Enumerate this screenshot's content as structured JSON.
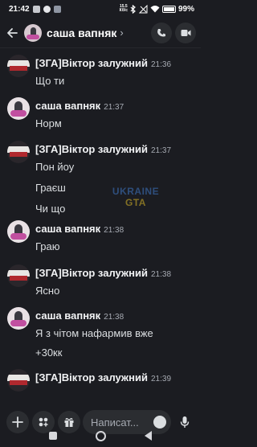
{
  "status_bar": {
    "time": "21:42",
    "network_speed": "15.5",
    "network_unit": "Кб/с",
    "battery": "99%"
  },
  "header": {
    "title": "саша вапняк",
    "chevron": "›",
    "back_icon": "arrow-left-icon",
    "call_icon": "phone-icon",
    "video_icon": "video-icon"
  },
  "messages": [
    {
      "author": "[ЗГА]Віктор залужний",
      "time": "21:36",
      "lines": [
        "Що ти"
      ]
    },
    {
      "author": "саша вапняк",
      "time": "21:37",
      "lines": [
        "Норм"
      ]
    },
    {
      "author": "[ЗГА]Віктор залужний",
      "time": "21:37",
      "lines": [
        "Пон йоу",
        "Граєш",
        "Чи що"
      ]
    },
    {
      "author": "саша вапняк",
      "time": "21:38",
      "lines": [
        "Граю"
      ]
    },
    {
      "author": "[ЗГА]Віктор залужний",
      "time": "21:38",
      "lines": [
        "Ясно"
      ]
    },
    {
      "author": "саша вапняк",
      "time": "21:38",
      "lines": [
        "Я з чітом нафармив вже",
        "+30кк"
      ]
    },
    {
      "author": "[ЗГА]Віктор залужний",
      "time": "21:39",
      "lines": []
    }
  ],
  "watermark": {
    "line1": "UKRAINE",
    "line2": "GTA"
  },
  "composer": {
    "placeholder": "Написат...",
    "add_icon": "plus-icon",
    "apps_icon": "apps-icon",
    "gift_icon": "gift-icon",
    "emoji_icon": "emoji-icon",
    "mic_icon": "microphone-icon"
  },
  "colors": {
    "background": "#1b1c21",
    "button_bg": "#2b2d31",
    "text_primary": "#f2f3f5",
    "text_muted": "#a6aab2"
  }
}
